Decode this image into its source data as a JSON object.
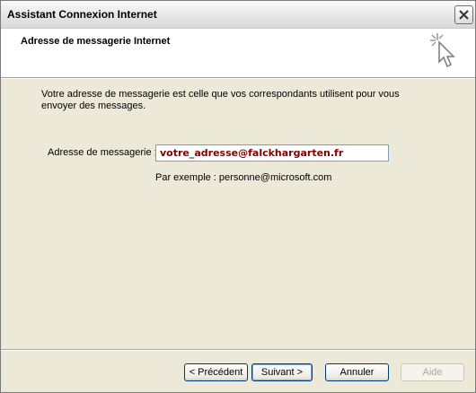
{
  "window": {
    "title": "Assistant Connexion Internet"
  },
  "header": {
    "title": "Adresse de messagerie Internet"
  },
  "body": {
    "intro": "Votre adresse de messagerie est celle que vos correspondants utilisent pour vous envoyer des messages.",
    "field_label": "Adresse de messagerie :",
    "email_value": "votre_adresse@falckhargarten.fr",
    "example": "Par exemple : personne@microsoft.com"
  },
  "buttons": {
    "previous": "< Précédent",
    "next": "Suivant >",
    "cancel": "Annuler",
    "help": "Aide"
  },
  "icons": {
    "close": "close-icon",
    "wizard": "wizard-cursor-icon"
  }
}
